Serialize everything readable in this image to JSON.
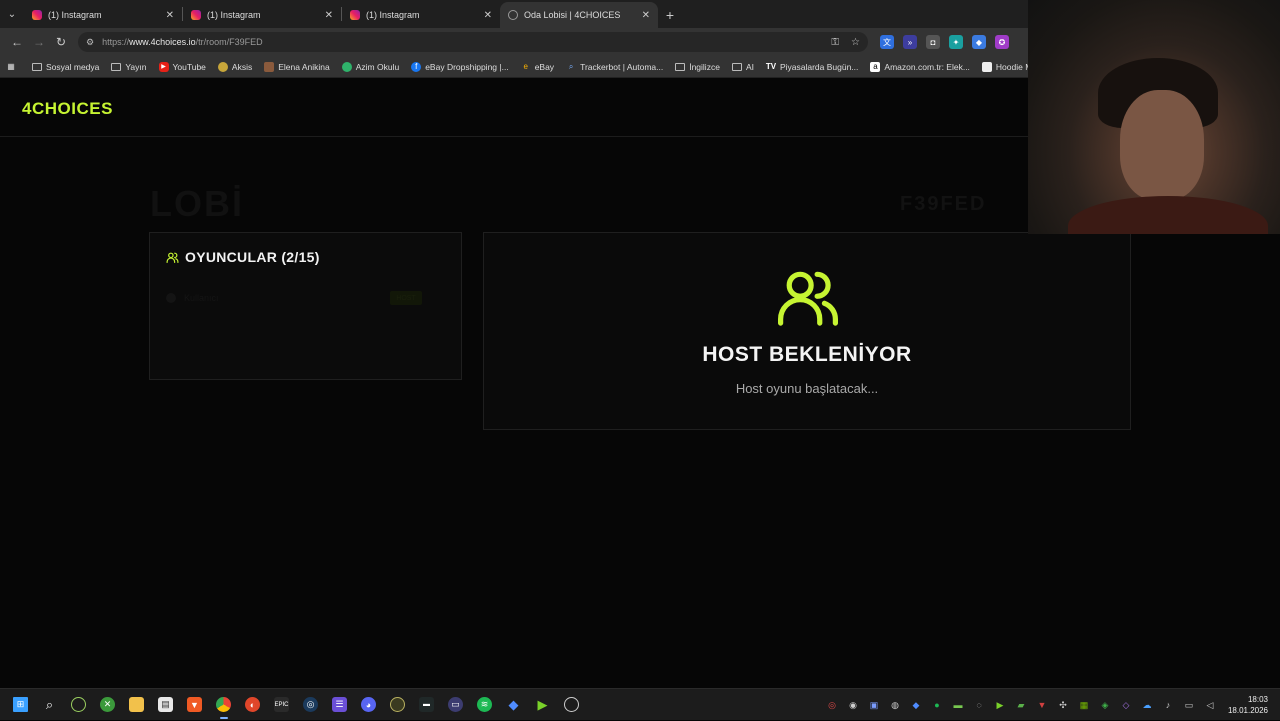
{
  "browser": {
    "tabs": [
      {
        "title": "(1) Instagram",
        "active": false,
        "icon": "instagram-icon"
      },
      {
        "title": "(1) Instagram",
        "active": false,
        "icon": "instagram-icon"
      },
      {
        "title": "(1) Instagram",
        "active": false,
        "icon": "instagram-icon"
      },
      {
        "title": "Oda Lobisi | 4CHOICES",
        "active": true,
        "icon": "globe-icon"
      }
    ],
    "new_tab_symbol": "+",
    "close_symbol": "✕",
    "url_prefix": "https://",
    "url_host": "www.4choices.io",
    "url_path": "/tr/room/F39FED",
    "bookmarks": [
      {
        "label": "Sosyal medya",
        "icon": "folder-icon"
      },
      {
        "label": "Yayın",
        "icon": "folder-icon"
      },
      {
        "label": "YouTube",
        "icon": "youtube-icon"
      },
      {
        "label": "Aksis",
        "icon": "aksis-icon"
      },
      {
        "label": "Elena Anikina",
        "icon": "profile-icon"
      },
      {
        "label": "Azim Okulu",
        "icon": "site-icon"
      },
      {
        "label": "eBay Dropshipping |...",
        "icon": "facebook-icon"
      },
      {
        "label": "eBay",
        "icon": "ebay-icon"
      },
      {
        "label": "Trackerbot | Automa...",
        "icon": "trackerbot-icon"
      },
      {
        "label": "İngilizce",
        "icon": "folder-icon"
      },
      {
        "label": "AI",
        "icon": "folder-icon"
      },
      {
        "label": "Piyasalarda Bugün...",
        "icon": "tv-icon"
      },
      {
        "label": "Amazon.com.tr: Elek...",
        "icon": "amazon-icon"
      },
      {
        "label": "Hoodie Modelleri |",
        "icon": "site-icon"
      }
    ]
  },
  "site": {
    "logo": "4CHOICES",
    "accent_color": "#c6f432",
    "lobby_title": "LOBİ",
    "room_code": "F39FED",
    "players": {
      "title": "OYUNCULAR (2/15)",
      "faint_row_name": "Kullanıcı",
      "faint_row_badge": "HOST"
    },
    "waiting": {
      "title": "HOST BEKLENİYOR",
      "subtitle": "Host oyunu başlatacak..."
    }
  },
  "taskbar": {
    "apps": [
      "windows-start-icon",
      "search-icon",
      "app-icon",
      "xbox-icon",
      "file-explorer-icon",
      "store-icon",
      "brave-icon",
      "chrome-icon",
      "opera-icon",
      "epic-games-icon",
      "steam-icon",
      "app-icon",
      "discord-icon",
      "app-icon",
      "app-icon",
      "app-icon",
      "spotify-icon",
      "app-icon",
      "app-icon",
      "obs-icon"
    ],
    "time": "18:03",
    "date": "18.01.2026"
  }
}
